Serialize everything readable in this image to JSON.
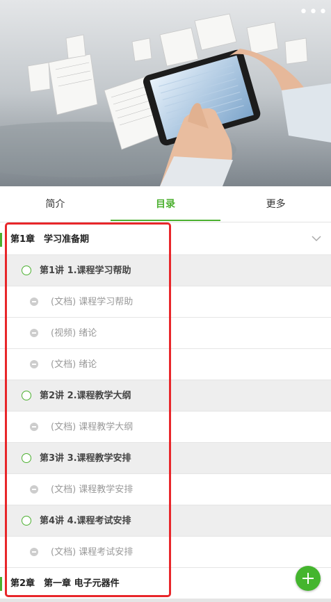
{
  "header": {
    "image_name": "tablet-hands-flying-papers",
    "more_icon": "more-dots-icon",
    "more_glyph": "•••"
  },
  "tabs": [
    {
      "label": "简介",
      "active": false
    },
    {
      "label": "目录",
      "active": true
    },
    {
      "label": "更多",
      "active": false
    }
  ],
  "catalog": {
    "chapters": [
      {
        "label": "第1章　学习准备期",
        "lessons": [
          {
            "label": "第1讲 1.课程学习帮助",
            "items": [
              "(文档) 课程学习帮助",
              "(视频) 绪论",
              "(文档) 绪论"
            ]
          },
          {
            "label": "第2讲 2.课程教学大纲",
            "items": [
              "(文档) 课程教学大纲"
            ]
          },
          {
            "label": "第3讲 3.课程教学安排",
            "items": [
              "(文档) 课程教学安排"
            ]
          },
          {
            "label": "第4讲 4.课程考试安排",
            "items": [
              "(文档) 课程考试安排"
            ]
          }
        ]
      },
      {
        "label": "第2章　第一章 电子元器件",
        "lessons": []
      }
    ]
  },
  "item_types": {
    "(文档)": "document-icon",
    "(视频)": "video-icon"
  },
  "colors": {
    "accent": "#4bb02f",
    "highlight": "#e8262a",
    "fab": "#44b52e"
  },
  "fab": {
    "icon": "plus-icon"
  }
}
